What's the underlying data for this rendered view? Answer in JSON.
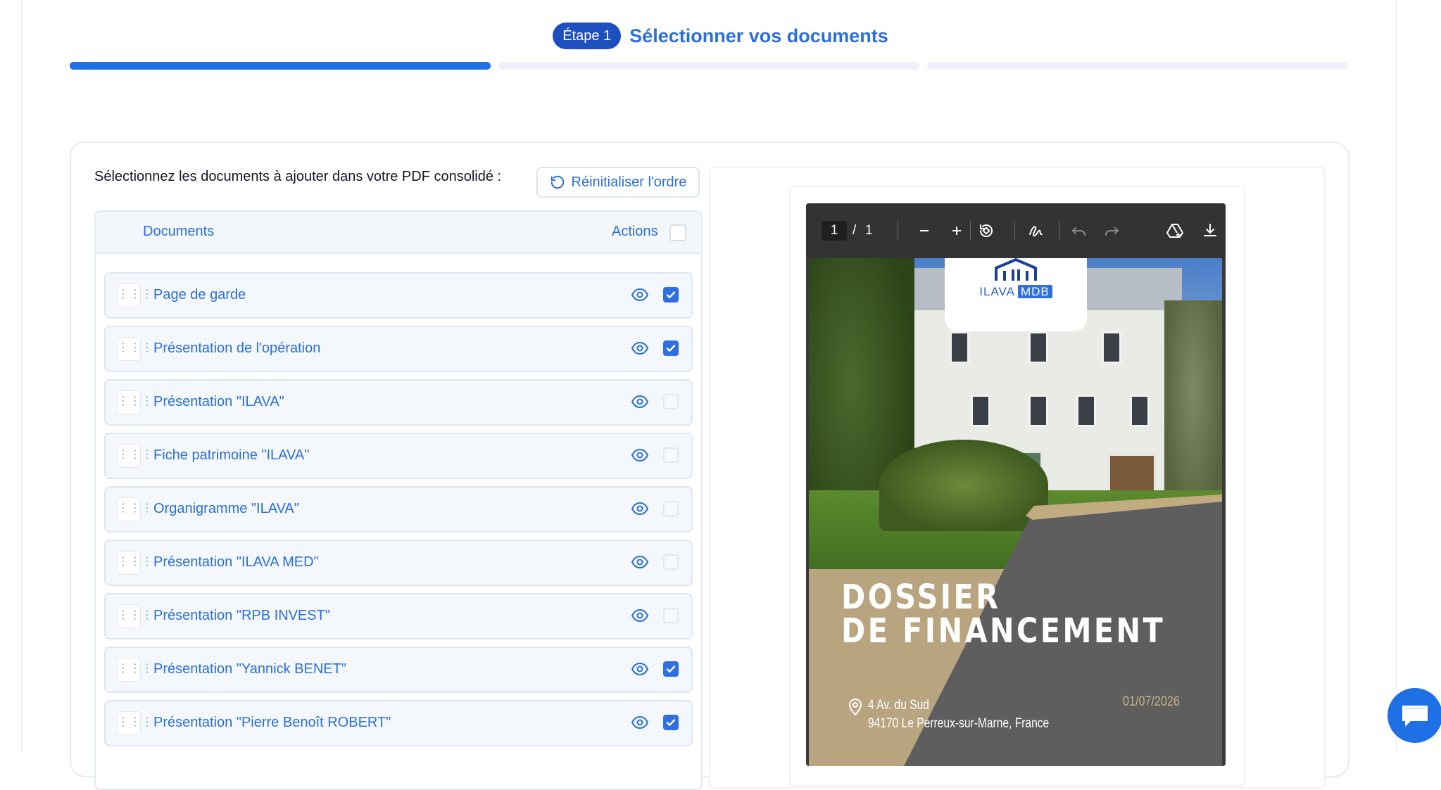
{
  "stepper": {
    "badge": "Étape 1",
    "title": "Sélectionner vos documents",
    "progress_fraction": 0.333
  },
  "instruction": "Sélectionnez les documents à ajouter dans votre PDF consolidé :",
  "reset_button": {
    "label": "Réinitialiser l'ordre",
    "icon": "rotate-ccw-icon"
  },
  "table": {
    "header_documents": "Documents",
    "header_actions": "Actions",
    "select_all_checked": false,
    "rows": [
      {
        "label": "Page de garde",
        "checked": true
      },
      {
        "label": "Présentation de l'opération",
        "checked": true
      },
      {
        "label": "Présentation \"ILAVA\"",
        "checked": false
      },
      {
        "label": "Fiche patrimoine \"ILAVA\"",
        "checked": false
      },
      {
        "label": "Organigramme \"ILAVA\"",
        "checked": false
      },
      {
        "label": "Présentation \"ILAVA MED\"",
        "checked": false
      },
      {
        "label": "Présentation \"RPB INVEST\"",
        "checked": false
      },
      {
        "label": "Présentation \"Yannick BENET\"",
        "checked": true
      },
      {
        "label": "Présentation \"Pierre Benoît ROBERT\"",
        "checked": true
      }
    ]
  },
  "pdf_viewer": {
    "current_page": "1",
    "separator": "/",
    "total_pages": "1",
    "toolbar_icons": [
      "zoom-out-icon",
      "zoom-in-icon",
      "rotate-icon",
      "draw-icon",
      "undo-icon",
      "redo-icon",
      "add-to-drive-icon",
      "download-icon"
    ],
    "cover": {
      "logo_text": "ILAVA",
      "logo_badge": "MDB",
      "title_line1": "DOSSIER",
      "title_line2": "DE FINANCEMENT",
      "address_line1": "4 Av. du Sud",
      "address_line2": "94170 Le Perreux-sur-Marne, France",
      "date": "01/07/2026"
    }
  },
  "colors": {
    "primary": "#1f6fe5",
    "badge": "#1e4fbf",
    "link_text": "#2a6fdb",
    "cover_tan": "#b8a580",
    "cover_gray": "#5e5e5e"
  }
}
